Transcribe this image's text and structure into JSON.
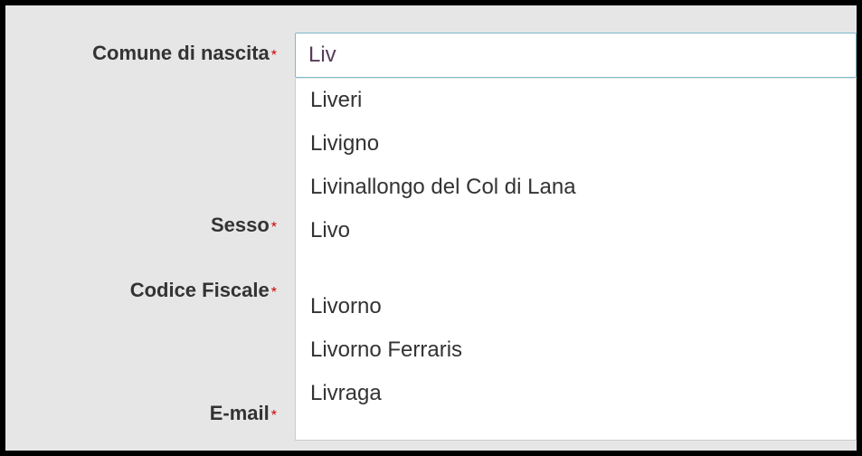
{
  "form": {
    "fields": {
      "comune_nascita": {
        "label": "Comune di nascita",
        "value": "Liv"
      },
      "sesso": {
        "label": "Sesso"
      },
      "codice_fiscale": {
        "label": "Codice Fiscale"
      },
      "email": {
        "label": "E-mail"
      }
    },
    "required_marker": "*"
  },
  "autocomplete": {
    "suggestions": [
      "Liveri",
      "Livigno",
      "Livinallongo del Col di Lana",
      "Livo",
      "Livorno",
      "Livorno Ferraris",
      "Livraga"
    ]
  }
}
